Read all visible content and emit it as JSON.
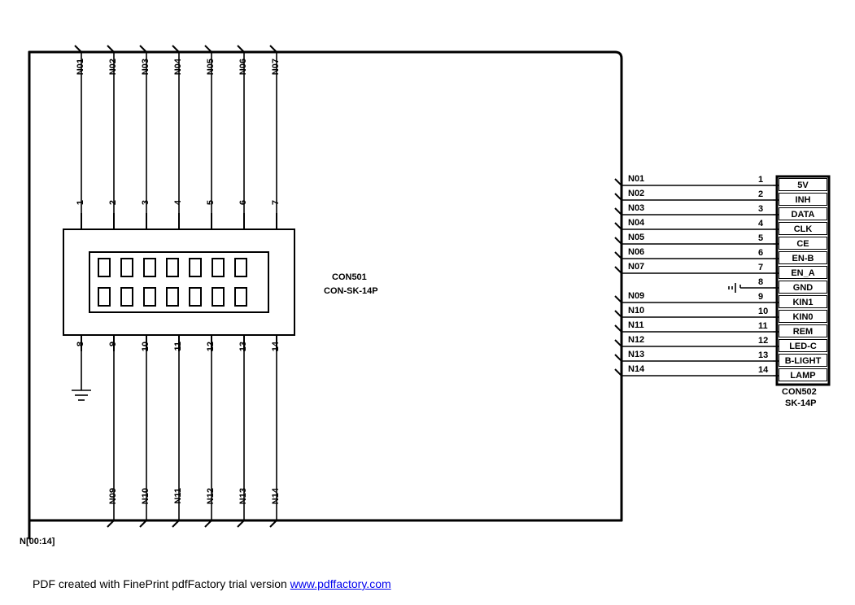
{
  "busLabel": "N[00:14]",
  "con501": {
    "ref": "CON501",
    "part": "CON-SK-14P",
    "topNets": [
      "N01",
      "N02",
      "N03",
      "N04",
      "N05",
      "N06",
      "N07"
    ],
    "topPins": [
      "1",
      "2",
      "3",
      "4",
      "5",
      "6",
      "7"
    ],
    "bottomPins": [
      "8",
      "9",
      "10",
      "11",
      "12",
      "13",
      "14"
    ],
    "bottomNets": [
      "",
      "N09",
      "N10",
      "N11",
      "N12",
      "N13",
      "N14"
    ]
  },
  "con502": {
    "ref": "CON502",
    "part": "SK-14P",
    "rows": [
      {
        "net": "N01",
        "pin": "1",
        "sig": "5V"
      },
      {
        "net": "N02",
        "pin": "2",
        "sig": "INH"
      },
      {
        "net": "N03",
        "pin": "3",
        "sig": "DATA"
      },
      {
        "net": "N04",
        "pin": "4",
        "sig": "CLK"
      },
      {
        "net": "N05",
        "pin": "5",
        "sig": "CE"
      },
      {
        "net": "N06",
        "pin": "6",
        "sig": "EN-B"
      },
      {
        "net": "N07",
        "pin": "7",
        "sig": "EN_A"
      },
      {
        "net": "",
        "pin": "8",
        "sig": "GND"
      },
      {
        "net": "N09",
        "pin": "9",
        "sig": "KIN1"
      },
      {
        "net": "N10",
        "pin": "10",
        "sig": "KIN0"
      },
      {
        "net": "N11",
        "pin": "11",
        "sig": "REM"
      },
      {
        "net": "N12",
        "pin": "12",
        "sig": "LED-C"
      },
      {
        "net": "N13",
        "pin": "13",
        "sig": "B-LIGHT"
      },
      {
        "net": "N14",
        "pin": "14",
        "sig": "LAMP"
      }
    ]
  },
  "footer": {
    "prefix": "PDF created with FinePrint pdfFactory trial version ",
    "linkText": "www.pdffactory.com"
  }
}
